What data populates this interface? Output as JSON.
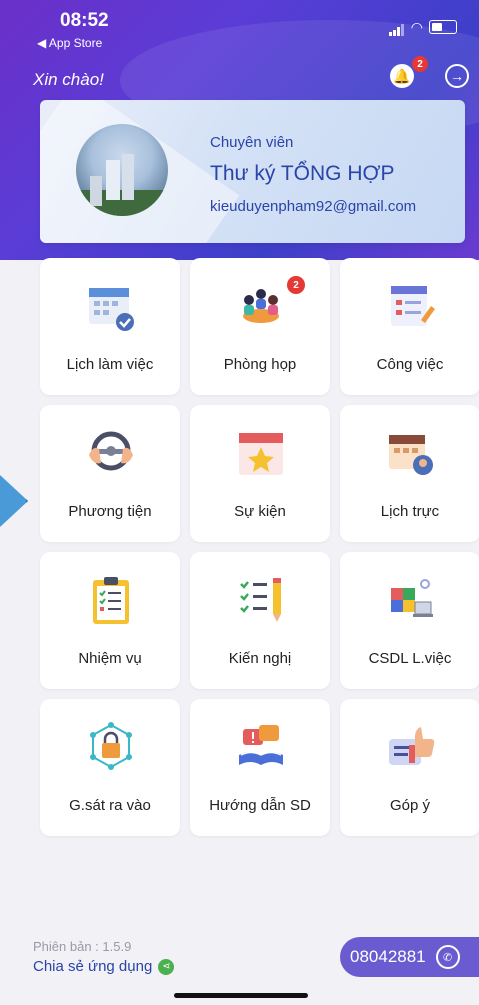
{
  "status_bar": {
    "time": "08:52",
    "back_label": "◀ App Store"
  },
  "header": {
    "greeting": "Xin chào!",
    "notification_count": "2"
  },
  "profile": {
    "role": "Chuyên viên",
    "name": "Thư ký TỔNG HỢP",
    "email": "kieuduyenpham92@gmail.com"
  },
  "menu": [
    {
      "label": "Lịch làm việc",
      "icon": "calendar-icon"
    },
    {
      "label": "Phòng họp",
      "icon": "meeting-room-icon",
      "badge": "2"
    },
    {
      "label": "Công việc",
      "icon": "task-list-icon"
    },
    {
      "label": "Phương tiện",
      "icon": "steering-wheel-icon"
    },
    {
      "label": "Sự kiện",
      "icon": "event-star-icon"
    },
    {
      "label": "Lịch trực",
      "icon": "duty-calendar-icon"
    },
    {
      "label": "Nhiệm vụ",
      "icon": "clipboard-icon"
    },
    {
      "label": "Kiến nghị",
      "icon": "checklist-pencil-icon"
    },
    {
      "label": "CSDL L.việc",
      "icon": "database-cubes-icon"
    },
    {
      "label": "G.sát ra vào",
      "icon": "access-lock-icon"
    },
    {
      "label": "Hướng dẫn SD",
      "icon": "guide-book-icon"
    },
    {
      "label": "Góp ý",
      "icon": "thumbs-up-feedback-icon"
    }
  ],
  "footer": {
    "version": "Phiên bản : 1.5.9",
    "share_label": "Chia sẻ ứng dụng",
    "phone": "08042881"
  },
  "colors": {
    "primary": "#5a3dd6",
    "text_blue": "#2a44a8",
    "badge_red": "#e53935"
  }
}
